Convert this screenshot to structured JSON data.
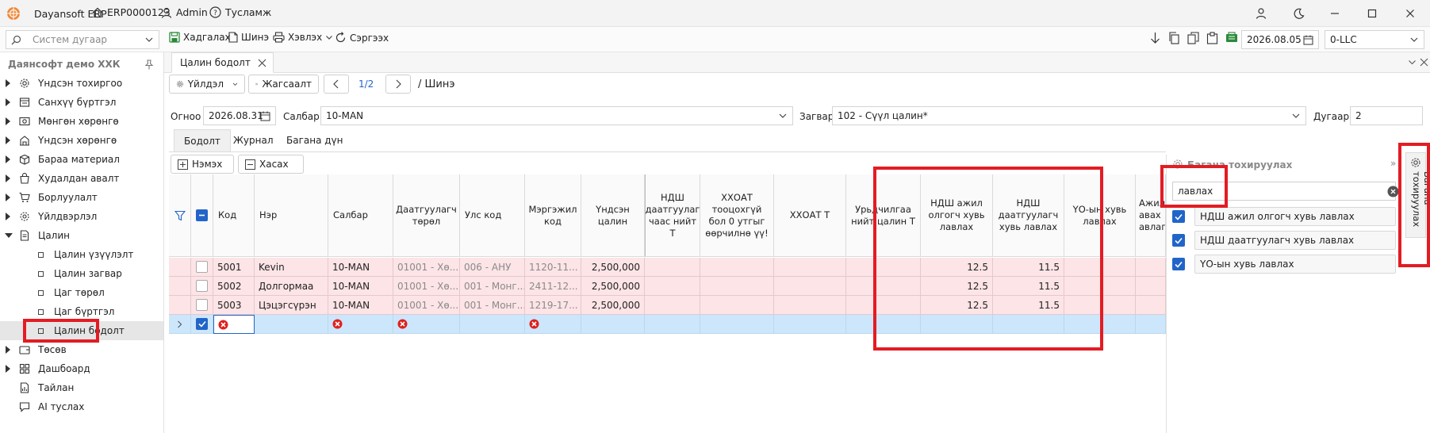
{
  "titlebar": {
    "app_name": "Dayansoft ERP",
    "company_code": "ERP0000123",
    "user": "Admin",
    "help": "Тусламж"
  },
  "toolbar": {
    "search_placeholder": "Систем дугаар",
    "save": "Хадгалах",
    "new": "Шинэ",
    "print": "Хэвлэх",
    "refresh": "Сэргээх",
    "date": "2026.08.05",
    "branch": "0-LLC"
  },
  "sidebar": {
    "company": "Даянсофт демо ХХК",
    "items": [
      {
        "label": "Үндсэн тохиргоо"
      },
      {
        "label": "Санхүү бүртгэл"
      },
      {
        "label": "Мөнгөн хөрөнгө"
      },
      {
        "label": "Үндсэн хөрөнгө"
      },
      {
        "label": "Бараа материал"
      },
      {
        "label": "Худалдан авалт"
      },
      {
        "label": "Борлуулалт"
      },
      {
        "label": "Үйлдвэрлэл"
      },
      {
        "label": "Цалин"
      }
    ],
    "sub_items": [
      {
        "label": "Цалин үзүүлэлт"
      },
      {
        "label": "Цалин загвар"
      },
      {
        "label": "Цаг төрөл"
      },
      {
        "label": "Цаг бүртгэл"
      },
      {
        "label": "Цалин бодолт"
      }
    ],
    "items_after": [
      {
        "label": "Төсөв"
      },
      {
        "label": "Дашбоард"
      },
      {
        "label": "Тайлан"
      },
      {
        "label": "AI туслах"
      }
    ]
  },
  "doc_tab": {
    "label": "Цалин бодолт"
  },
  "actions": {
    "actions_label": "Үйлдэл",
    "list_label": "Жагсаалт",
    "pager": "1/2",
    "mode": "/ Шинэ"
  },
  "form": {
    "date_label": "Огноо",
    "date_value": "2026.08.31",
    "branch_label": "Салбар",
    "branch_value": "10-MAN",
    "template_label": "Загвар",
    "template_value": "102 - Сүүл цалин*",
    "number_label": "Дугаар",
    "number_value": "2"
  },
  "inner_tabs": [
    {
      "label": "Бодолт"
    },
    {
      "label": "Журнал"
    },
    {
      "label": "Багана дүн"
    }
  ],
  "grid_actions": {
    "add": "Нэмэх",
    "remove": "Хасах"
  },
  "grid": {
    "headers": {
      "code": "Код",
      "name": "Нэр",
      "branch": "Салбар",
      "insurer_type": "Даатгуулагч төрөл",
      "country": "Улс код",
      "profession": "Мэргэжил код",
      "base_salary": "Үндсэн цалин",
      "ndsh_insured_total": "НДШ даатгуулаг чаас нийт Т",
      "hhoat_zero": "ХХОАТ тооцохгүй бол 0 утгыг өөрчилнө үү!",
      "hhoat": "ХХОАТ Т",
      "advance": "Урьдчилгаа нийт цалин Т",
      "ndsh_employer_ref": "НДШ ажил олгогч хувь лавлах",
      "ndsh_insured_ref": "НДШ даатгуулагч хувь лавлах",
      "yo_ref": "ҮО-ын хувь лавлах",
      "receivable": "Ажилчдаас авах авлага"
    },
    "rows": [
      {
        "code": "5001",
        "name": "Kevin",
        "branch": "10-MAN",
        "insurer_type": "01001 - Хө...",
        "country": "006 - АНУ",
        "profession": "1120-11...",
        "base_salary": "2,500,000",
        "ndsh_employer": "12.5",
        "ndsh_insured": "11.5"
      },
      {
        "code": "5002",
        "name": "Долгормаа",
        "branch": "10-MAN",
        "insurer_type": "01001 - Хө...",
        "country": "001 - Монг...",
        "profession": "2411-12...",
        "base_salary": "2,500,000",
        "ndsh_employer": "12.5",
        "ndsh_insured": "11.5"
      },
      {
        "code": "5003",
        "name": "Цэцэгсүрэн",
        "branch": "10-MAN",
        "insurer_type": "01001 - Хө...",
        "country": "001 - Монг...",
        "profession": "1219-17...",
        "base_salary": "2,500,000",
        "ndsh_employer": "12.5",
        "ndsh_insured": "11.5"
      }
    ]
  },
  "column_panel": {
    "title": "Багана тохируулах",
    "search_value": "лавлах",
    "side_tab": "Багана тохируулах",
    "items": [
      {
        "label": "НДШ ажил олгогч хувь лавлах"
      },
      {
        "label": "НДШ даатгуулагч хувь лавлах"
      },
      {
        "label": "ҮО-ын хувь лавлах"
      }
    ]
  },
  "colors": {
    "row_pink": "#fde4e6",
    "row_blue": "#cce6fb",
    "accent": "#2265c8",
    "highlight": "#e31c23",
    "error": "#e0201c"
  }
}
